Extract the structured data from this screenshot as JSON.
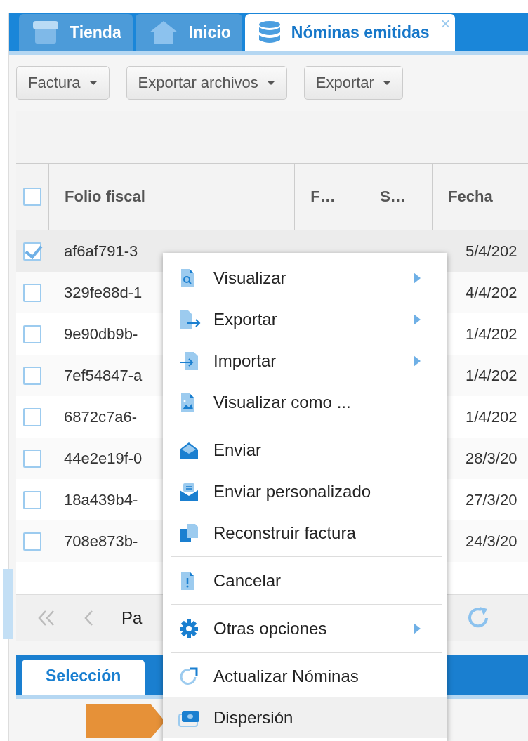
{
  "tabs": [
    {
      "label": "Tienda",
      "selected": false
    },
    {
      "label": "Inicio",
      "selected": false
    },
    {
      "label": "Nóminas emitidas",
      "selected": true,
      "close": "×"
    }
  ],
  "toolbar": {
    "buttons": [
      "Factura",
      "Exportar archivos",
      "Exportar"
    ]
  },
  "grid": {
    "header_checked": false,
    "columns": [
      "Folio fiscal",
      "F…",
      "S…",
      "Fecha"
    ],
    "rows": [
      {
        "checked": true,
        "folio": "af6af791-3",
        "fecha": "5/4/202"
      },
      {
        "checked": false,
        "folio": "329fe88d-1",
        "fecha": "4/4/202"
      },
      {
        "checked": false,
        "folio": "9e90db9b-",
        "fecha": "1/4/202"
      },
      {
        "checked": false,
        "folio": "7ef54847-a",
        "fecha": "1/4/202"
      },
      {
        "checked": false,
        "folio": "6872c7a6-",
        "fecha": "1/4/202"
      },
      {
        "checked": false,
        "folio": "44e2e19f-0",
        "fecha": "28/3/20"
      },
      {
        "checked": false,
        "folio": "18a439b4-",
        "fecha": "27/3/20"
      },
      {
        "checked": false,
        "folio": "708e873b-",
        "fecha": "24/3/20"
      }
    ]
  },
  "pager": {
    "text": "Pa"
  },
  "bottom_tabs": [
    {
      "label": "Selección",
      "selected": true
    }
  ],
  "context_menu": [
    {
      "kind": "item",
      "label": "Visualizar",
      "submenu": true,
      "highlighted": false
    },
    {
      "kind": "item",
      "label": "Exportar",
      "submenu": true,
      "highlighted": false
    },
    {
      "kind": "item",
      "label": "Importar",
      "submenu": true,
      "highlighted": false
    },
    {
      "kind": "item",
      "label": "Visualizar como ...",
      "submenu": false,
      "highlighted": false
    },
    {
      "kind": "separator"
    },
    {
      "kind": "item",
      "label": "Enviar",
      "submenu": false,
      "highlighted": false
    },
    {
      "kind": "item",
      "label": "Enviar personalizado",
      "submenu": false,
      "highlighted": false
    },
    {
      "kind": "item",
      "label": "Reconstruir factura",
      "submenu": false,
      "highlighted": false
    },
    {
      "kind": "separator"
    },
    {
      "kind": "item",
      "label": "Cancelar",
      "submenu": false,
      "highlighted": false
    },
    {
      "kind": "separator"
    },
    {
      "kind": "item",
      "label": "Otras opciones",
      "submenu": true,
      "highlighted": false
    },
    {
      "kind": "separator"
    },
    {
      "kind": "item",
      "label": "Actualizar Nóminas",
      "submenu": false,
      "highlighted": false
    },
    {
      "kind": "item",
      "label": "Dispersión",
      "submenu": false,
      "highlighted": true
    }
  ]
}
